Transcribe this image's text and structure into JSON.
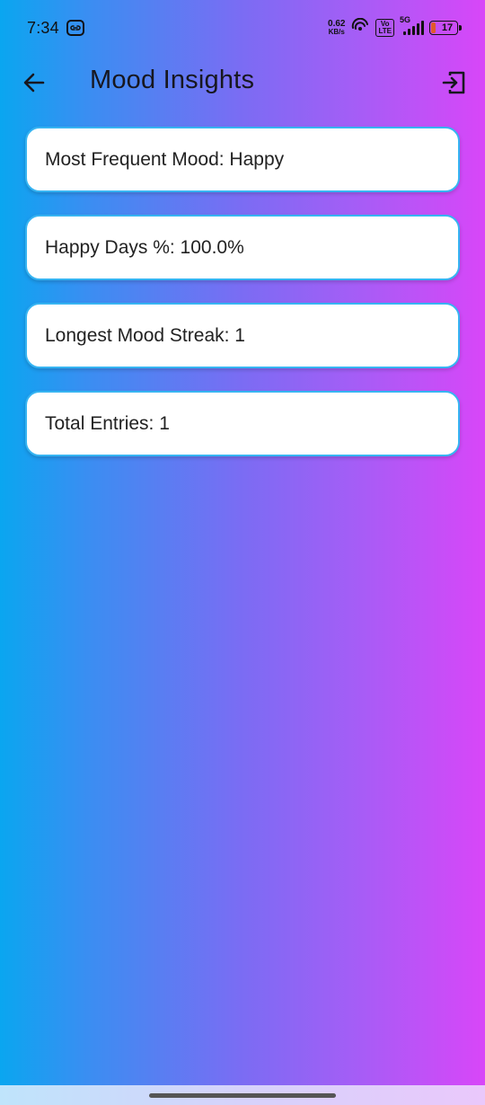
{
  "status_bar": {
    "time": "7:34",
    "net_speed_value": "0.62",
    "net_speed_unit": "KB/s",
    "volte": "Vo\nLTE",
    "network": "5G",
    "battery": "17"
  },
  "app_bar": {
    "title": "Mood Insights",
    "back_icon": "arrow-left-icon",
    "logout_icon": "logout-icon"
  },
  "insights": [
    {
      "label": "Most Frequent Mood: Happy"
    },
    {
      "label": "Happy Days %: 100.0%"
    },
    {
      "label": "Longest Mood Streak: 1"
    },
    {
      "label": "Total Entries: 1"
    }
  ],
  "colors": {
    "gradient_start": "#0aa6f0",
    "gradient_end": "#d846f8",
    "card_border": "#36b4f2",
    "card_bg": "#ffffff"
  }
}
